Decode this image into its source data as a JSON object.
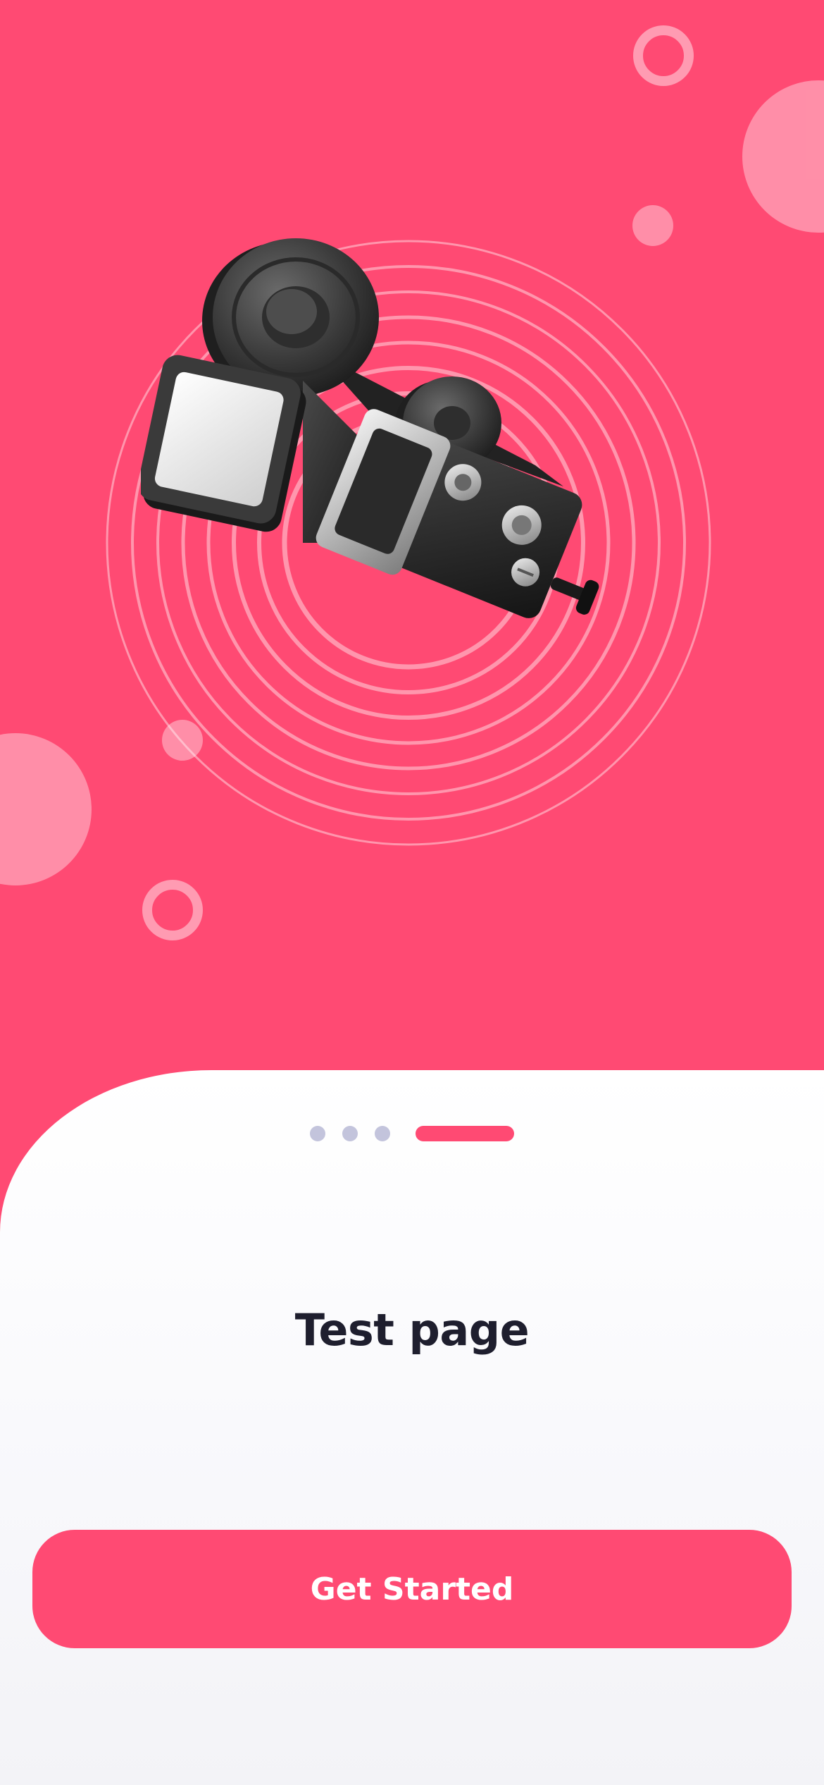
{
  "colors": {
    "primary": "#ff4a73",
    "title": "#1e1e2e",
    "dot_inactive": "#c3c4dc",
    "card": "#ffffff"
  },
  "hero": {
    "illustration_icon": "movie-camera-icon"
  },
  "pagination": {
    "total": 4,
    "current": 4
  },
  "content": {
    "title": "Test page"
  },
  "cta": {
    "label": "Get Started"
  }
}
